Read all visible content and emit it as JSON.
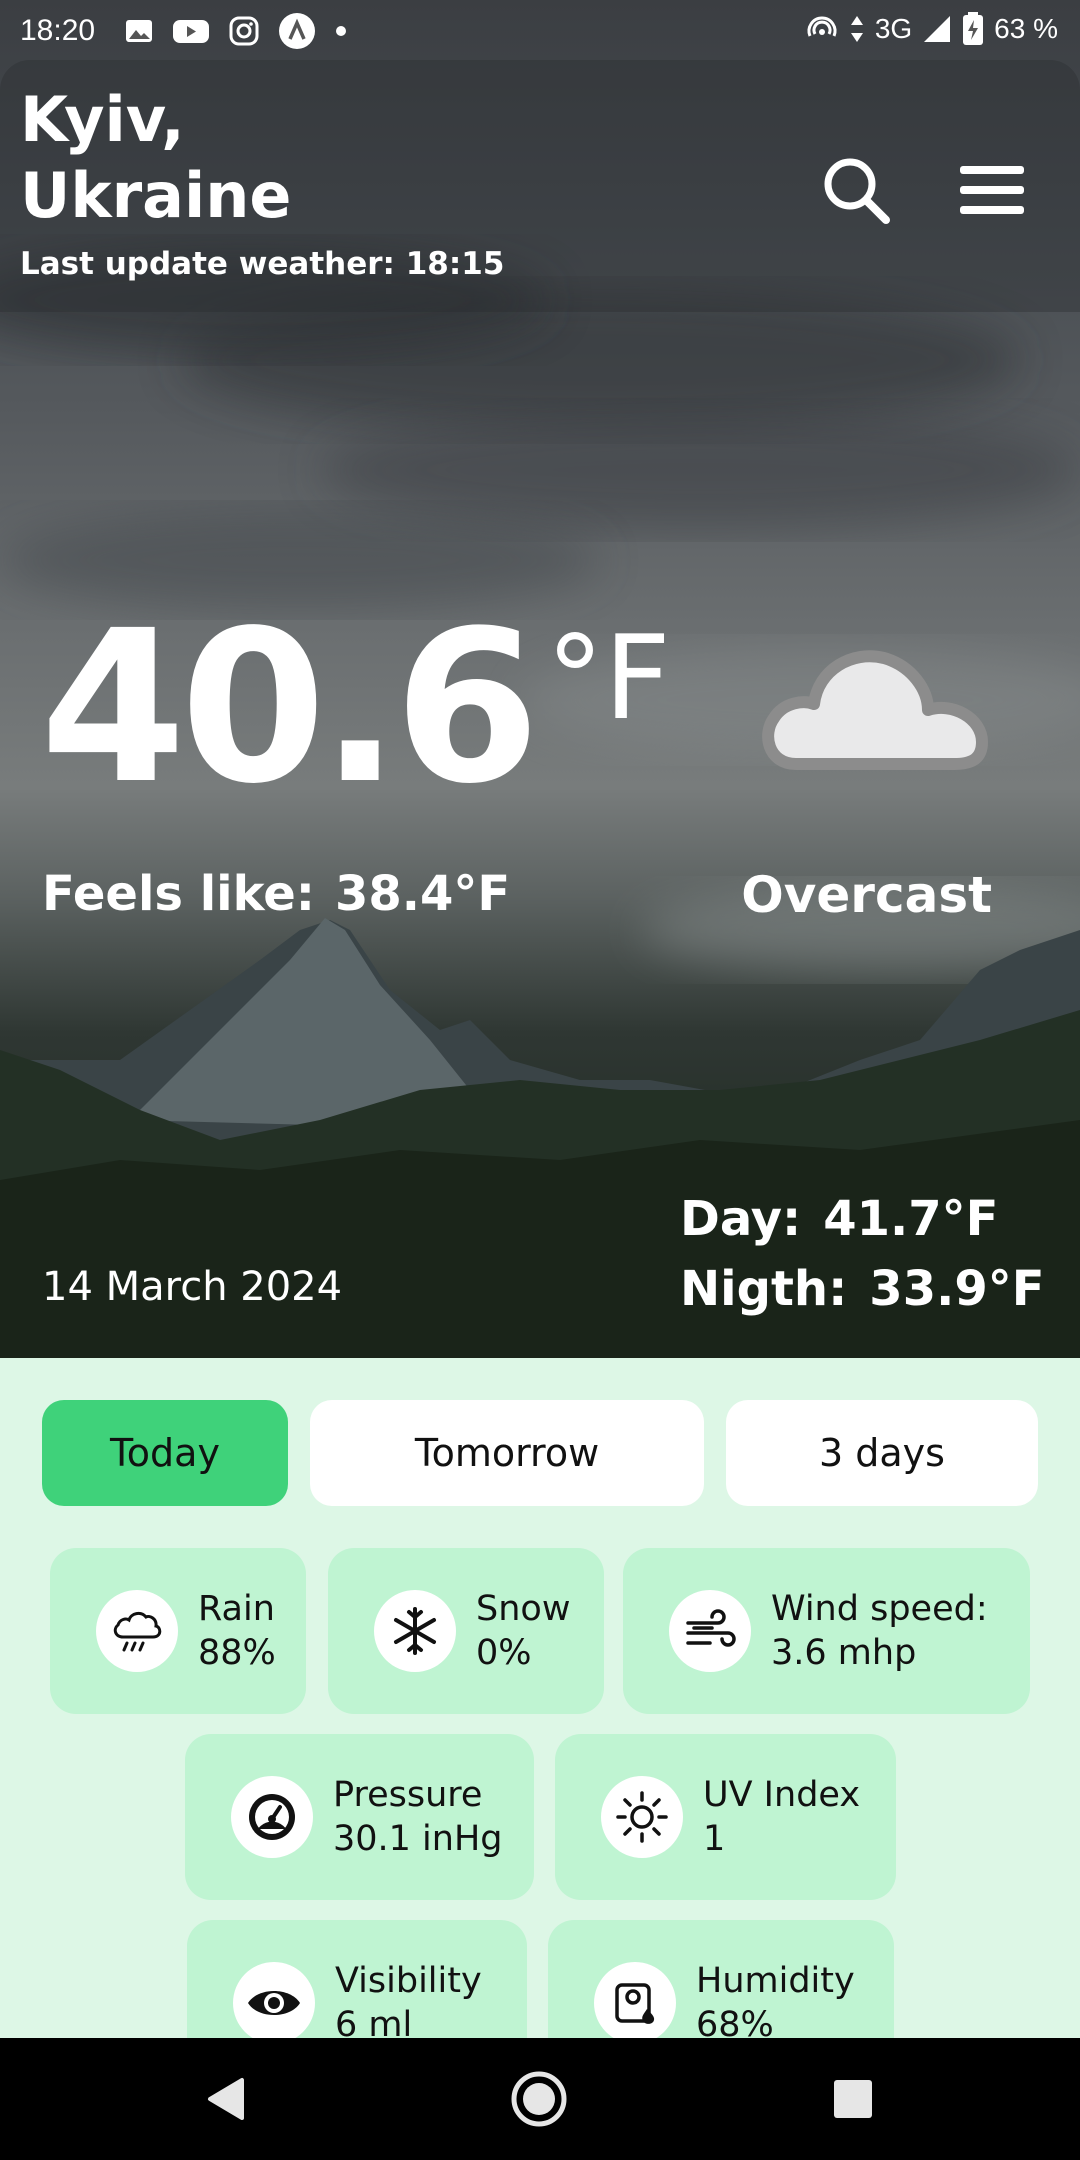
{
  "status_bar": {
    "time": "18:20",
    "network": "3G",
    "battery": "63 %",
    "icons": [
      "gallery-icon",
      "youtube-icon",
      "instagram-icon",
      "app-icon",
      "dot-icon",
      "hotspot-icon",
      "data-arrows-icon",
      "signal-icon",
      "battery-icon"
    ]
  },
  "header": {
    "city_line1": "Kyiv,",
    "city_line2": "Ukraine",
    "last_update": "Last update weather: 18:15",
    "search_icon": "search-icon",
    "menu_icon": "menu-icon"
  },
  "current": {
    "temperature": "40.6",
    "unit": "°F",
    "feels_label": "Feels like:",
    "feels_value": "38.4°F",
    "condition": "Overcast",
    "condition_icon": "cloud-icon",
    "date": "14 March 2024",
    "day_label": "Day:",
    "day_value": "41.7°F",
    "night_label": "Nigth:",
    "night_value": "33.9°F"
  },
  "tabs": [
    {
      "label": "Today",
      "active": true
    },
    {
      "label": "Tomorrow",
      "active": false
    },
    {
      "label": "3 days",
      "active": false
    }
  ],
  "details": {
    "rain": {
      "label": "Rain",
      "value": "88%",
      "icon": "rain-cloud-icon"
    },
    "snow": {
      "label": "Snow",
      "value": "0%",
      "icon": "snowflake-icon"
    },
    "wind": {
      "label": "Wind speed:",
      "value": "3.6 mhp",
      "icon": "wind-icon"
    },
    "pressure": {
      "label": "Pressure",
      "value": "30.1 inHg",
      "icon": "gauge-icon"
    },
    "uv": {
      "label": "UV Index",
      "value": "1",
      "icon": "sun-icon"
    },
    "visibility": {
      "label": "Visibility",
      "value": "6 ml",
      "icon": "eye-icon"
    },
    "humidity": {
      "label": "Humidity",
      "value": "68%",
      "icon": "humidity-icon"
    }
  },
  "colors": {
    "panel_bg": "#ddf7e6",
    "card_bg": "#bff4d2",
    "active_tab": "#3fd27a",
    "tab_bg": "#ffffff"
  },
  "nav_bar": {
    "icons": [
      "back-icon",
      "home-icon",
      "recents-icon"
    ]
  }
}
